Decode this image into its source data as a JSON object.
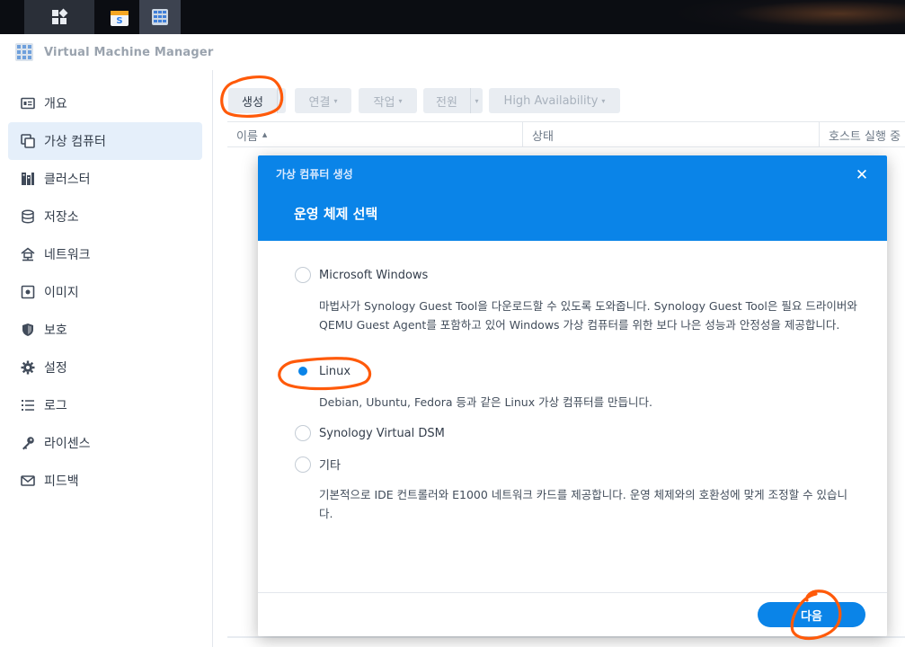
{
  "app": {
    "title": "Virtual Machine Manager"
  },
  "colors": {
    "accent": "#0a84e8",
    "annotation": "#ff5a0a",
    "sidebar_active": "#e5effa"
  },
  "sidebar": {
    "items": [
      {
        "label": "개요",
        "icon": "overview-icon"
      },
      {
        "label": "가상 컴퓨터",
        "icon": "virtual-machine-icon",
        "active": true
      },
      {
        "label": "클러스터",
        "icon": "cluster-icon"
      },
      {
        "label": "저장소",
        "icon": "storage-icon"
      },
      {
        "label": "네트워크",
        "icon": "network-icon"
      },
      {
        "label": "이미지",
        "icon": "image-icon"
      },
      {
        "label": "보호",
        "icon": "shield-icon"
      },
      {
        "label": "설정",
        "icon": "gear-icon"
      },
      {
        "label": "로그",
        "icon": "log-list-icon"
      },
      {
        "label": "라이센스",
        "icon": "key-icon"
      },
      {
        "label": "피드백",
        "icon": "mail-icon"
      }
    ]
  },
  "toolbar": {
    "create": "생성",
    "connect": "연결",
    "action": "작업",
    "power": "전원",
    "ha": "High Availability"
  },
  "table": {
    "columns": [
      "이름",
      "상태",
      "호스트 실행 중"
    ],
    "sort_indicator": "▲"
  },
  "dialog": {
    "window_title": "가상 컴퓨터 생성",
    "heading": "운영 체제 선택",
    "close_symbol": "✕",
    "options": [
      {
        "label": "Microsoft Windows",
        "checked": false,
        "description": "마법사가 Synology Guest Tool을 다운로드할 수 있도록 도와줍니다. Synology Guest Tool은 필요 드라이버와 QEMU Guest Agent를 포함하고 있어 Windows 가상 컴퓨터를 위한 보다 나은 성능과 안정성을 제공합니다."
      },
      {
        "label": "Linux",
        "checked": true,
        "description": "Debian, Ubuntu, Fedora 등과 같은 Linux 가상 컴퓨터를 만듭니다."
      },
      {
        "label": "Synology Virtual DSM",
        "checked": false,
        "description": ""
      },
      {
        "label": "기타",
        "checked": false,
        "description": "기본적으로 IDE 컨트롤러와 E1000 네트워크 카드를 제공합니다. 운영 체제와의 호환성에 맞게 조정할 수 있습니다."
      }
    ],
    "next_button": "다음"
  }
}
